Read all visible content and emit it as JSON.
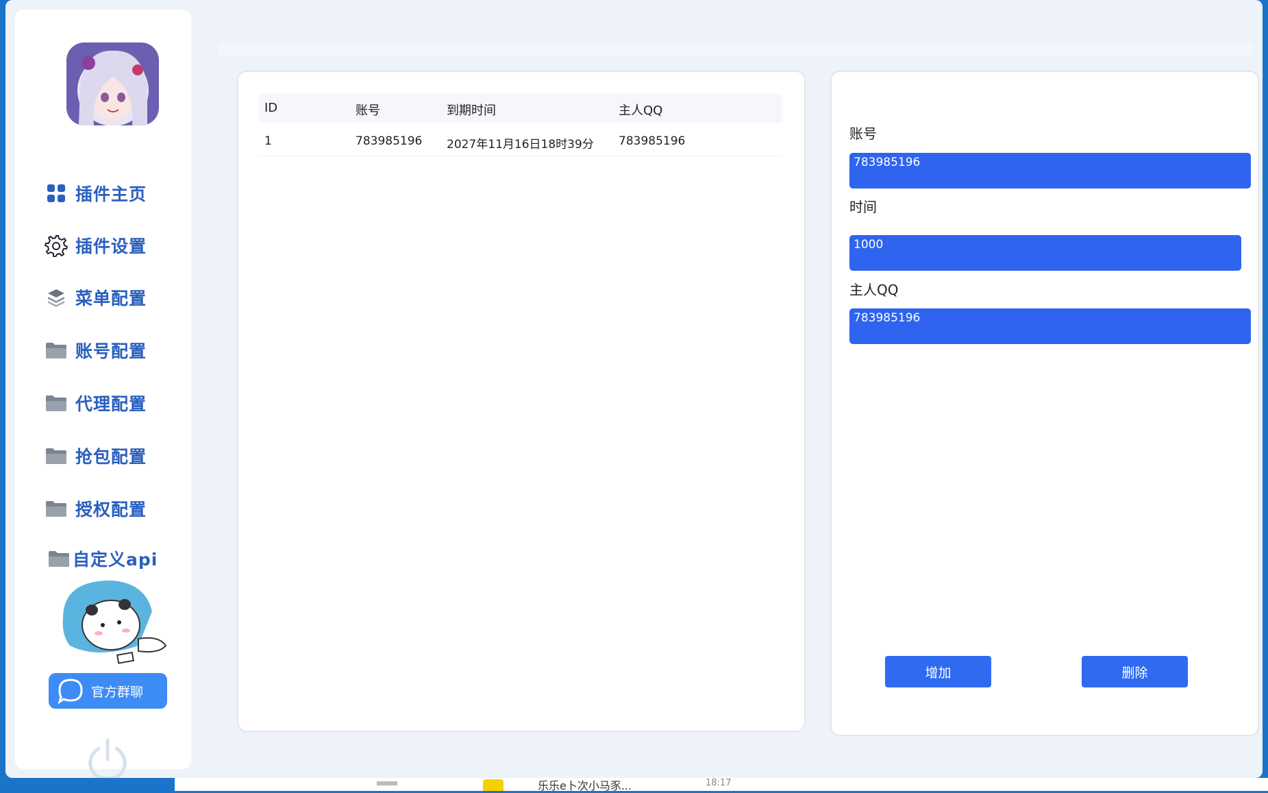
{
  "sidebar": {
    "items": [
      {
        "label": "插件主页",
        "icon": "grid-icon"
      },
      {
        "label": "插件设置",
        "icon": "gear-icon"
      },
      {
        "label": "菜单配置",
        "icon": "layers-icon"
      },
      {
        "label": "账号配置",
        "icon": "folder-icon"
      },
      {
        "label": "代理配置",
        "icon": "folder-icon"
      },
      {
        "label": "抢包配置",
        "icon": "folder-icon"
      },
      {
        "label": "授权配置",
        "icon": "folder-icon"
      },
      {
        "label": "自定义api",
        "icon": "folder-icon"
      }
    ],
    "group_button": "官方群聊"
  },
  "table": {
    "headers": [
      "ID",
      "账号",
      "到期时间",
      "主人QQ"
    ],
    "rows": [
      [
        "1",
        "783985196",
        "2027年11月16日18时39分",
        "783985196"
      ]
    ]
  },
  "form": {
    "account_label": "账号",
    "account_value": "783985196",
    "time_label": "时间",
    "time_value": "1000",
    "owner_label": "主人QQ",
    "owner_value": "783985196",
    "add_button": "增加",
    "delete_button": "删除"
  },
  "taskbar": {
    "item_text": "乐乐e卜次小马豕...",
    "time": "18:17"
  },
  "colors": {
    "accent": "#2f64ef",
    "nav_text": "#2a5fbf",
    "desktop": "#1b74c9"
  }
}
